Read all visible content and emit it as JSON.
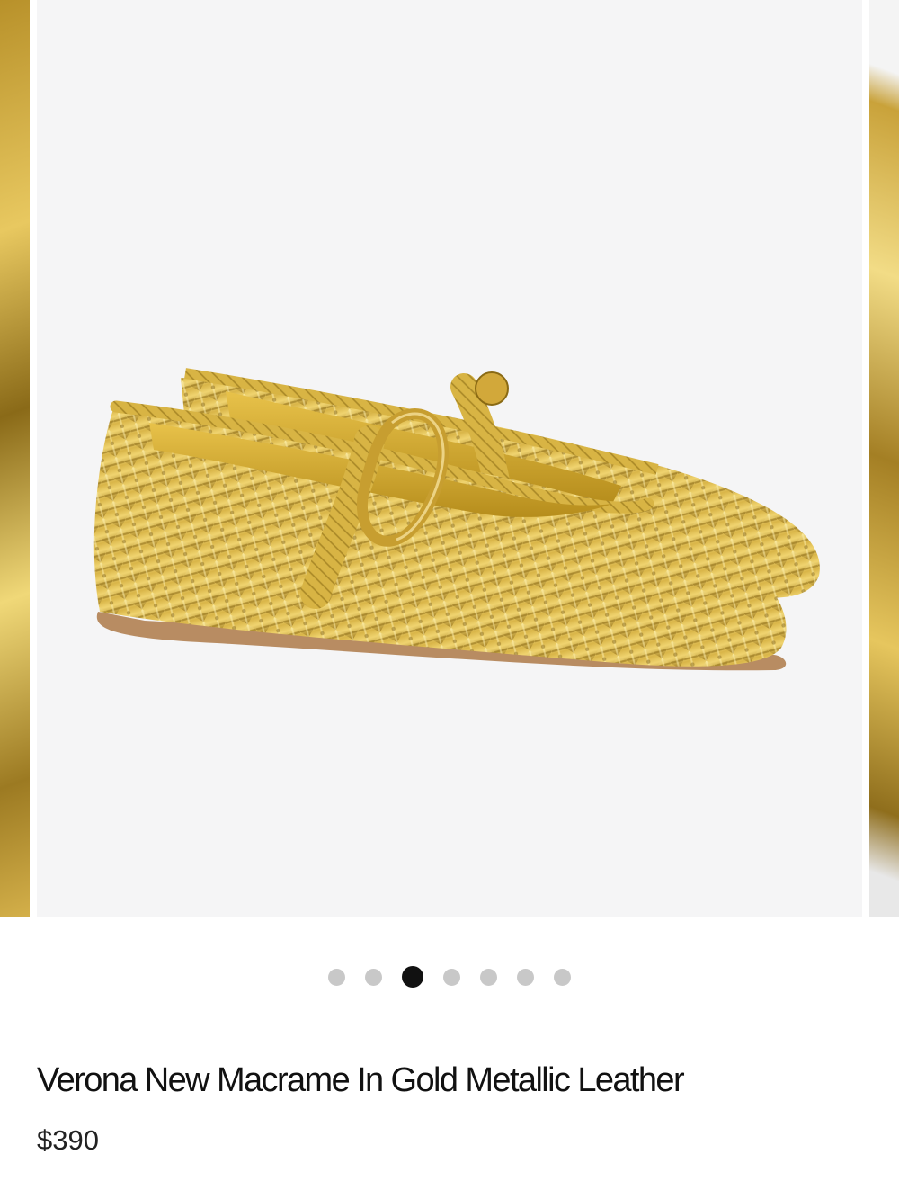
{
  "product": {
    "title": "Verona New Macrame In Gold Metallic Leather",
    "price": "$390"
  },
  "carousel": {
    "total_slides": 7,
    "active_index": 2
  },
  "colors": {
    "gold": "#d9b548",
    "gold_dark": "#a07c1e",
    "gold_light": "#f3df8c",
    "image_background": "#f5f5f6",
    "dot_inactive": "#c8c8c8",
    "dot_active": "#111111"
  }
}
